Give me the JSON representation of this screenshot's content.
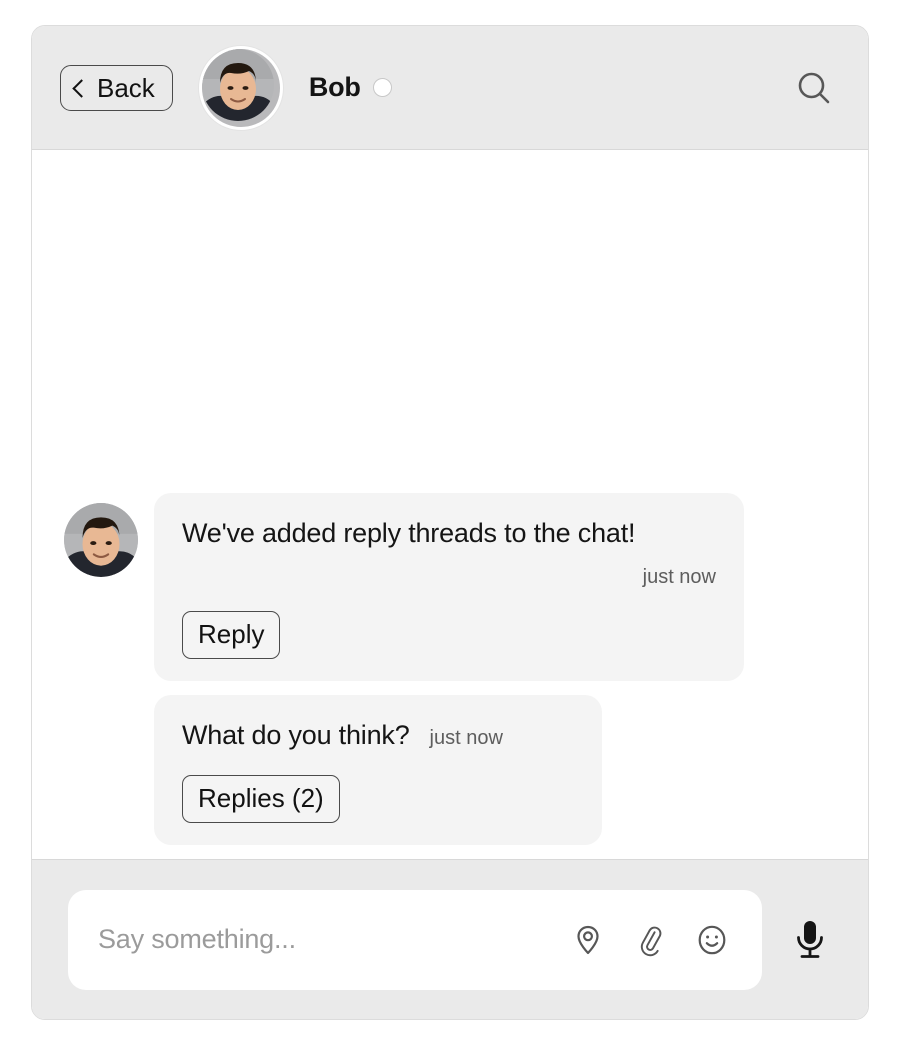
{
  "header": {
    "back_label": "Back",
    "contact_name": "Bob",
    "status": "offline",
    "avatar_alt": "Bob avatar",
    "search_icon": "search-icon",
    "back_icon": "chevron-left-icon",
    "status_icon": "status-circle-icon"
  },
  "messages": [
    {
      "id": "msg-1",
      "sender": "Bob",
      "text": "We've added reply threads to the chat!",
      "timestamp": "just now",
      "action_label": "Reply",
      "show_avatar": true
    },
    {
      "id": "msg-2",
      "sender": "Bob",
      "text": "What do you think?",
      "timestamp": "just now",
      "action_label": "Replies (2)",
      "show_avatar": false
    }
  ],
  "composer": {
    "placeholder": "Say something...",
    "value": "",
    "icons": [
      {
        "name": "location-pin-icon",
        "label": "Share location"
      },
      {
        "name": "paperclip-icon",
        "label": "Attach file"
      },
      {
        "name": "smiley-icon",
        "label": "Insert emoji"
      }
    ],
    "mic_icon": "microphone-icon"
  },
  "colors": {
    "header_background": "#eaeaea",
    "chat_background": "#ffffff",
    "bubble_background": "#f4f4f4",
    "text_primary": "#151515",
    "text_muted": "#5d5d5d",
    "placeholder": "#9b9b9b",
    "border": "#dcdcdc",
    "button_border": "#4a4a4a"
  }
}
